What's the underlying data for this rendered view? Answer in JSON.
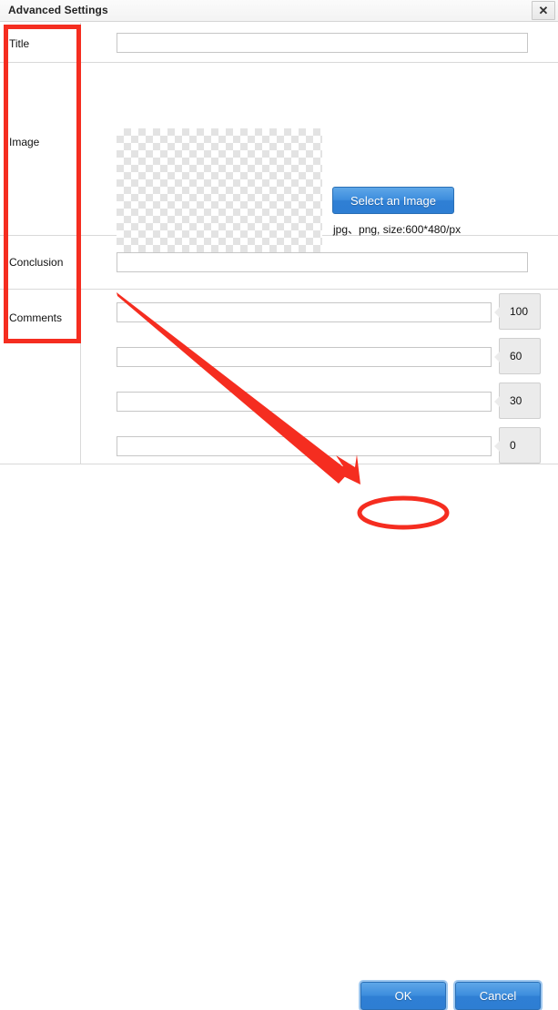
{
  "window": {
    "title": "Advanced Settings",
    "close_label": "✕",
    "close_icon": "close-icon"
  },
  "form": {
    "rows": [
      {
        "label": "Title",
        "input_value": "",
        "placeholder": ""
      },
      {
        "label": "Image",
        "input_value": "",
        "placeholder": ""
      },
      {
        "label": "Conclusion",
        "input_value": "",
        "placeholder": ""
      },
      {
        "label": "Comments",
        "input_value": "",
        "placeholder": ""
      }
    ]
  },
  "image_field": {
    "select_button_label": "Select an Image",
    "hint": "jpg、png, size:600*480/px",
    "placeholder_state": "empty-transparent-checkerboard"
  },
  "comments": {
    "entries": [
      {
        "text": "",
        "score": "100"
      },
      {
        "text": "",
        "score": "60"
      },
      {
        "text": "",
        "score": "30"
      },
      {
        "text": "",
        "score": "0"
      }
    ]
  },
  "footer": {
    "ok_label": "OK",
    "cancel_label": "Cancel"
  },
  "annotations": {
    "color": "#f52d20",
    "rect_target": "label-column",
    "arrow_from_comments_to_ok": true,
    "ellipse_target": "ok-button"
  }
}
